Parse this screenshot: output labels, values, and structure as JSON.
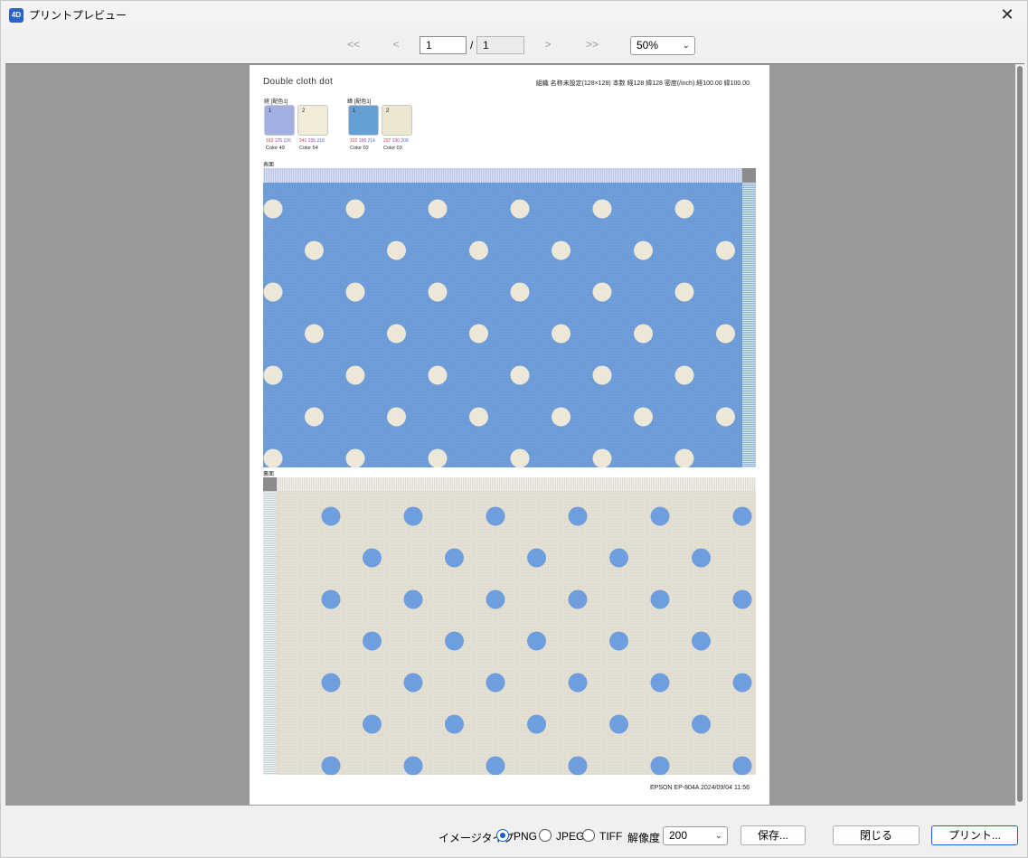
{
  "window": {
    "title": "プリントプレビュー",
    "app_icon_text": "4D",
    "close_glyph": "✕"
  },
  "nav": {
    "first": "<<",
    "prev": "<",
    "next": ">",
    "last": ">>",
    "page_current": "1",
    "page_sep": "/",
    "page_total": "1",
    "zoom": "50%"
  },
  "page": {
    "title": "Double cloth dot",
    "meta": "組織 名称未設定(128×128)  本数 経128 緯128  密度(/inch) 経100.00 緯100.00",
    "warp_label": "経 [配色1]",
    "weft_label": "緯 [配色1]",
    "swatches": [
      {
        "num": "1",
        "r": "163",
        "g": "176",
        "b": "226",
        "name": "Color 49",
        "color": "#a3b0e2"
      },
      {
        "num": "2",
        "r": "241",
        "g": "235",
        "b": "218",
        "name": "Color 54",
        "color": "#f1ebda"
      },
      {
        "num": "1",
        "r": "102",
        "g": "158",
        "b": "214",
        "name": "Color 02",
        "color": "#669ed6"
      },
      {
        "num": "2",
        "r": "237",
        "g": "230",
        "b": "208",
        "name": "Color 03",
        "color": "#ede6d0"
      }
    ],
    "front_label": "表面",
    "back_label": "裏面",
    "footer": "EPSON EP-804A    2024/09/04 11:56"
  },
  "bottom": {
    "image_type_label": "イメージタイプ",
    "opt_png": "PNG",
    "opt_jpeg": "JPEG",
    "opt_tiff": "TIFF",
    "resolution_label": "解像度",
    "resolution_value": "200",
    "save": "保存...",
    "close": "閉じる",
    "print": "プリント..."
  },
  "colors": {
    "front_ground": "#6c9bd8",
    "front_dot": "#ece7d6",
    "back_ground": "#e3e0d3",
    "back_dot": "#6e9ede",
    "accent": "#1a61c8"
  }
}
